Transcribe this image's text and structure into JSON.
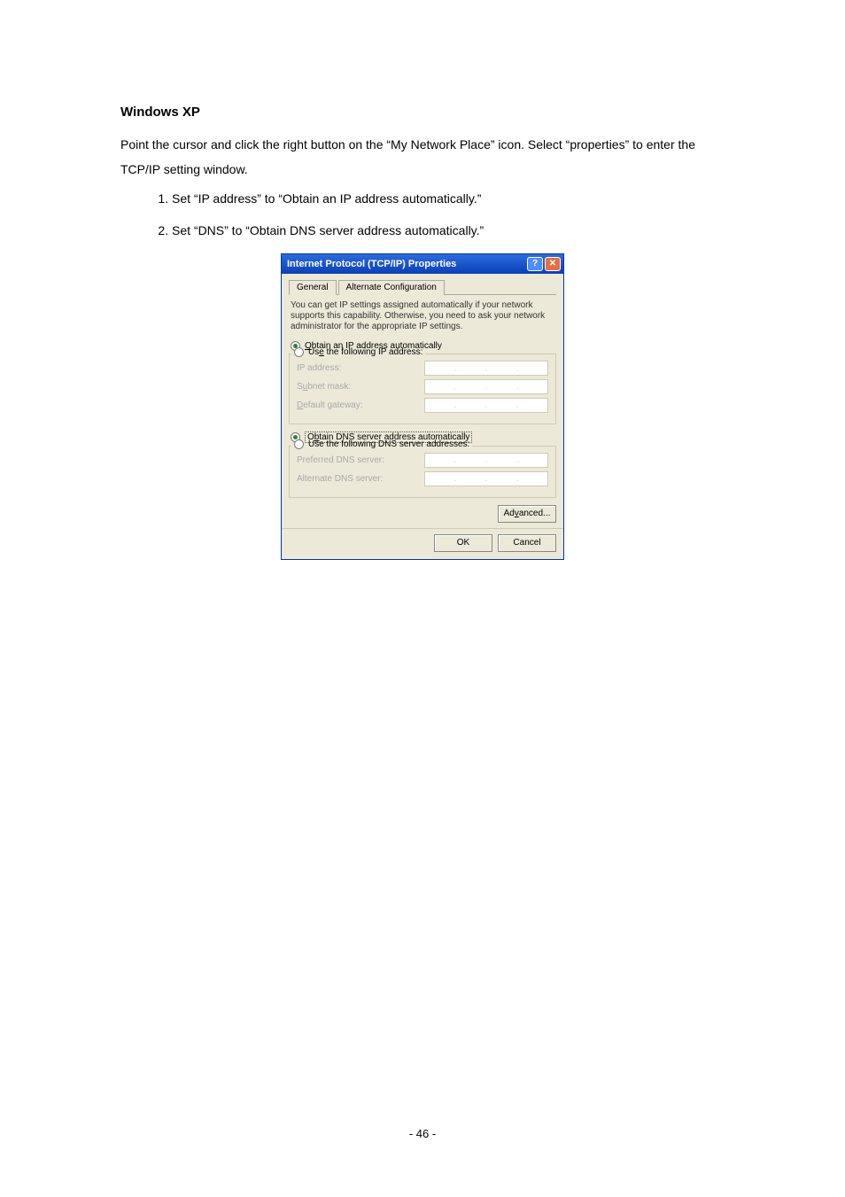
{
  "doc": {
    "heading": "Windows XP",
    "intro": "Point the cursor and click the right button on the “My Network Place” icon. Select “properties” to enter the TCP/IP setting window.",
    "steps": [
      "Set “IP address” to “Obtain an IP address automatically.”",
      "Set “DNS” to “Obtain DNS server address automatically.”"
    ],
    "page_number": "- 46 -"
  },
  "dialog": {
    "title": "Internet Protocol (TCP/IP) Properties",
    "tabs": {
      "general": "General",
      "alt": "Alternate Configuration"
    },
    "description": "You can get IP settings assigned automatically if your network supports this capability. Otherwise, you need to ask your network administrator for the appropriate IP settings.",
    "ip": {
      "obtain_pre": "O",
      "obtain_post": "btain an IP address automatically",
      "use_pre": "Us",
      "use_u": "e",
      "use_post": " the following IP address:",
      "ip_label": "IP address:",
      "subnet_pre": "S",
      "subnet_u": "u",
      "subnet_post": "bnet mask:",
      "gateway_pre": "",
      "gateway_u": "D",
      "gateway_post": "efault gateway:"
    },
    "dns": {
      "obtain_pre": "O",
      "obtain_u": "b",
      "obtain_post": "tain DNS server address automatically",
      "use_pre": "Use the following DNS server addresses:",
      "pref_pre": "Preferred DNS server:",
      "alt_pre": "Alternate DNS server:"
    },
    "buttons": {
      "advanced_pre": "Ad",
      "advanced_u": "v",
      "advanced_post": "anced...",
      "ok": "OK",
      "cancel": "Cancel"
    }
  }
}
